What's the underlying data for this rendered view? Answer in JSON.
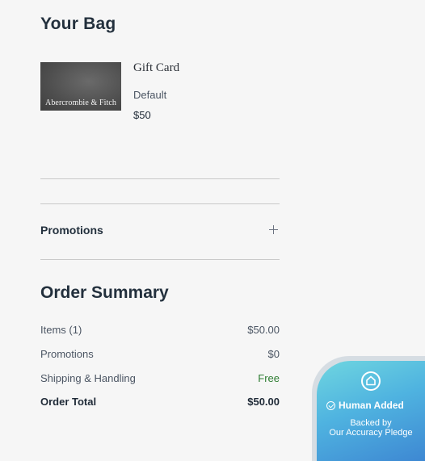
{
  "bag": {
    "title": "Your Bag",
    "item": {
      "thumbnail_brand": "Abercrombie & Fitch",
      "name": "Gift Card",
      "variant": "Default",
      "price": "$50"
    }
  },
  "promotions": {
    "label": "Promotions",
    "toggle_icon": "plus-icon"
  },
  "summary": {
    "title": "Order Summary",
    "rows": [
      {
        "label": "Items (1)",
        "value": "$50.00"
      },
      {
        "label": "Promotions",
        "value": "$0"
      },
      {
        "label": "Shipping & Handling",
        "value": "Free"
      },
      {
        "label": "Order Total",
        "value": "$50.00"
      }
    ]
  },
  "badge": {
    "icon": "home-icon",
    "headline": "Human Added",
    "line1": "Backed by",
    "line2": "Our Accuracy Pledge"
  },
  "colors": {
    "background": "#f6f6f6",
    "heading": "#23303d",
    "free_green": "#2e7d32",
    "badge_gradient_start": "#6fd6e0",
    "badge_gradient_end": "#3d86d2"
  }
}
